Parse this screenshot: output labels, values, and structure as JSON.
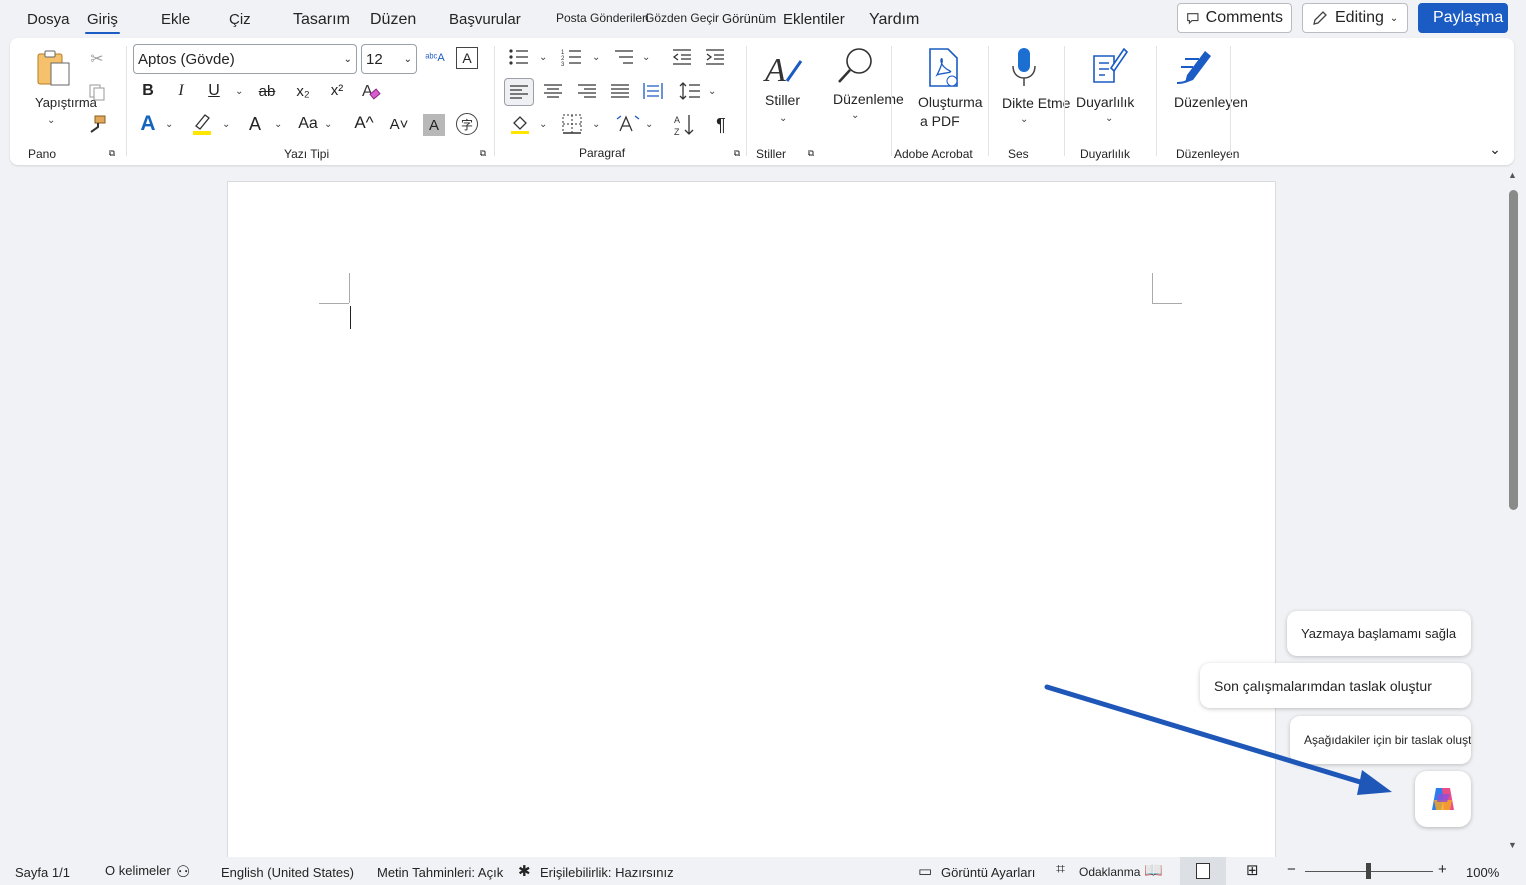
{
  "tabs": {
    "dosya": "Dosya",
    "giris": "Giriş",
    "ekle": "Ekle",
    "ciz": "Çiz",
    "tasarim": "Tasarım",
    "duzen": "Düzen",
    "basvurular": "Başvurular",
    "posta": "Posta Gönderileri",
    "gozden": "Gözden Geçir",
    "gorunum": "Görünüm",
    "eklentiler": "Eklentiler",
    "yardim": "Yardım"
  },
  "top_buttons": {
    "comments": "Comments",
    "editing": "Editing",
    "share": "Paylaşma"
  },
  "ribbon": {
    "paste_label": "Yapıştırma",
    "font_name": "Aptos (Gövde)",
    "font_size": "12",
    "bold": "B",
    "italic": "I",
    "underline": "U",
    "strike": "ab",
    "sub": "x₂",
    "sup": "x²",
    "grow": "A^",
    "shrink": "A˅",
    "case": "Aa",
    "font_color": "A",
    "aa_label": "A",
    "styles_label": "Stiller",
    "editing_label": "Düzenleme",
    "pdf_label_1": "Oluşturma",
    "pdf_label_2": "a PDF",
    "dictate_label": "Dikte Etme",
    "sensitivity_label": "Duyarlılık",
    "editor_label": "Düzenleyen",
    "groups": {
      "pano": "Pano",
      "yazi_tipi": "Yazı Tipi",
      "paragraf": "Paragraf",
      "stiller": "Stiller",
      "adobe": "Adobe Acrobat",
      "ses": "Ses",
      "duyarlilik": "Duyarlılık",
      "duzenleyen": "Düzenleyen"
    }
  },
  "copilot": {
    "suggestion_1": "Yazmaya başlamamı sağla",
    "suggestion_2": "Son çalışmalarımdan taslak oluştur",
    "suggestion_3": "Aşağıdakiler için bir taslak oluştur..."
  },
  "status": {
    "page": "Sayfa 1/1",
    "words": "O kelimeler",
    "language": "English (United States)",
    "predictions": "Metin Tahminleri: Açık",
    "accessibility": "Erişilebilirlik: Hazırsınız",
    "display": "Görüntü Ayarları",
    "focus": "Odaklanma",
    "zoom": "100%"
  },
  "colors": {
    "accent": "#1a5bc4",
    "share_bg": "#1a5bc4",
    "arrow": "#1f57b8",
    "highlight": "#ffe600",
    "font_color": "#1565c0"
  }
}
